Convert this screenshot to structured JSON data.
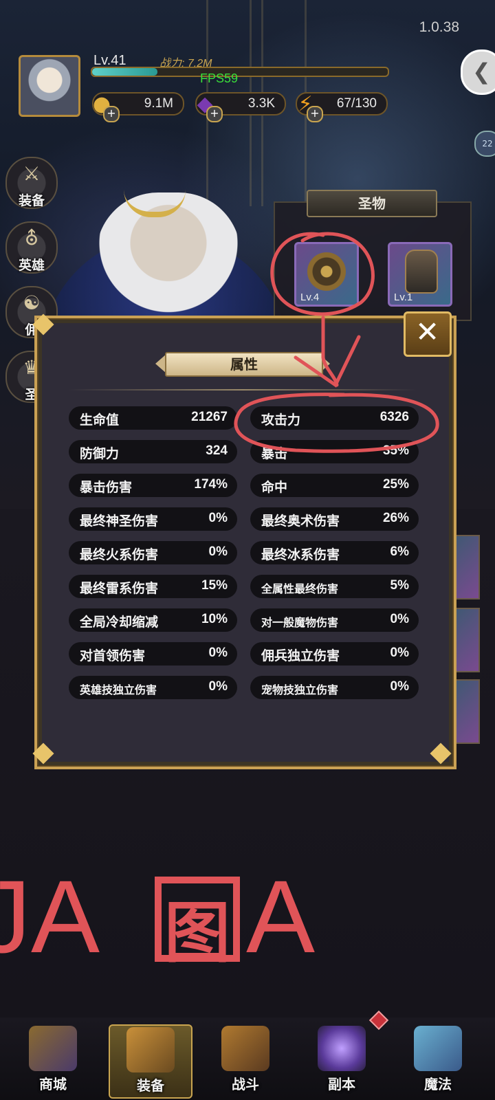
{
  "app": {
    "version": "1.0.38",
    "fps": "FPS59"
  },
  "player": {
    "level": "Lv.41",
    "power": "战力: 7.2M",
    "xp_fraction": 0.22
  },
  "resources": [
    {
      "name": "gold",
      "icon": "coin-icon",
      "value": "9.1M"
    },
    {
      "name": "gem",
      "icon": "gem-icon",
      "value": "3.3K"
    },
    {
      "name": "energy",
      "icon": "lightning-icon",
      "value": "67/130"
    }
  ],
  "left_menu": [
    {
      "label": "装备",
      "icon": "equipment-icon"
    },
    {
      "label": "英雄",
      "icon": "helmet-icon"
    },
    {
      "label": "佣",
      "icon": "handshake-icon"
    },
    {
      "label": "圣",
      "icon": "trophy-icon"
    }
  ],
  "relics": {
    "title": "圣物",
    "items": [
      {
        "level": "Lv.4",
        "icon": "amulet-icon"
      },
      {
        "level": "Lv.1",
        "icon": "gauntlet-icon"
      }
    ]
  },
  "dialog": {
    "title": "属性",
    "close_icon": "close-icon",
    "stats": [
      {
        "name": "生命值",
        "value": "21267"
      },
      {
        "name": "攻击力",
        "value": "6326"
      },
      {
        "name": "防御力",
        "value": "324"
      },
      {
        "name": "暴击",
        "value": "35%"
      },
      {
        "name": "暴击伤害",
        "value": "174%"
      },
      {
        "name": "命中",
        "value": "25%"
      },
      {
        "name": "最终神圣伤害",
        "value": "0%"
      },
      {
        "name": "最终奥术伤害",
        "value": "26%"
      },
      {
        "name": "最终火系伤害",
        "value": "0%"
      },
      {
        "name": "最终冰系伤害",
        "value": "6%"
      },
      {
        "name": "最终雷系伤害",
        "value": "15%"
      },
      {
        "name": "全属性最终伤害",
        "value": "5%"
      },
      {
        "name": "全局冷却缩减",
        "value": "10%"
      },
      {
        "name": "对一般魔物伤害",
        "value": "0%"
      },
      {
        "name": "对首领伤害",
        "value": "0%"
      },
      {
        "name": "佣兵独立伤害",
        "value": "0%"
      },
      {
        "name": "英雄技独立伤害",
        "value": "0%"
      },
      {
        "name": "宠物技独立伤害",
        "value": "0%"
      }
    ]
  },
  "overlay_text": {
    "left": "JA",
    "right": "A",
    "stamp": "图"
  },
  "bottom_nav": [
    {
      "label": "商城",
      "icon": "shop-icon"
    },
    {
      "label": "装备",
      "icon": "chest-icon",
      "active": true
    },
    {
      "label": "战斗",
      "icon": "battle-icon"
    },
    {
      "label": "副本",
      "icon": "portal-icon"
    },
    {
      "label": "魔法",
      "icon": "spellbook-icon"
    }
  ],
  "colors": {
    "accent_gold": "#caa154",
    "annotation_red": "#e05458",
    "fps_green": "#3adf3a"
  }
}
